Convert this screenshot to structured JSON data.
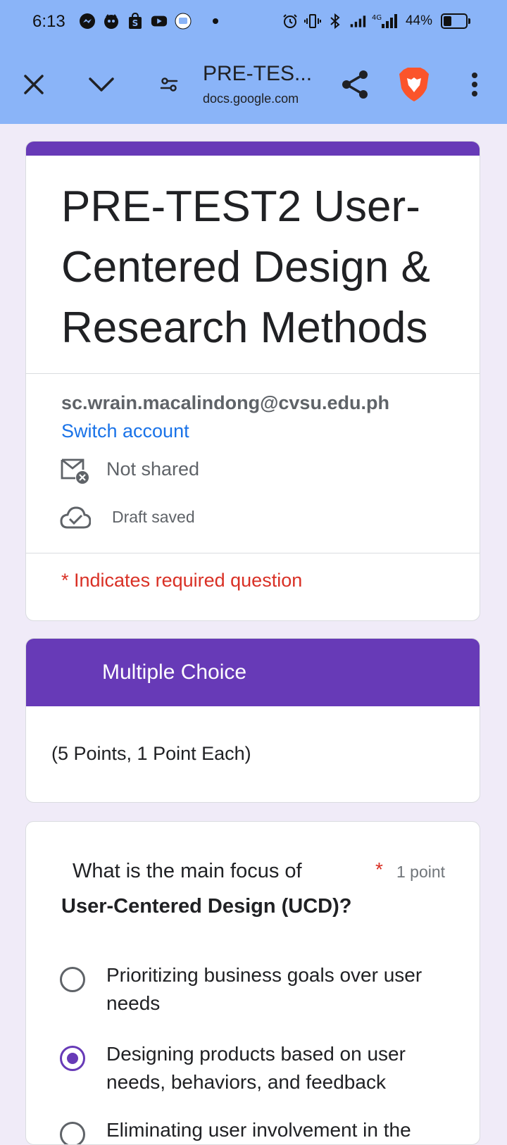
{
  "status_bar": {
    "time": "6:13",
    "network": "4G",
    "battery": "44%",
    "battery_level": 0.44,
    "icons_left": [
      "messenger-icon",
      "cat-app-icon",
      "shopee-icon",
      "youtube-icon",
      "screen-record-icon"
    ],
    "icons_right": [
      "alarm-icon",
      "vibrate-icon",
      "bluetooth-icon",
      "signal-icon",
      "signal-4g-icon"
    ]
  },
  "toolbar": {
    "title": "PRE-TES...",
    "url": "docs.google.com",
    "icons": [
      "close-icon",
      "chevron-down-icon",
      "site-settings-icon",
      "share-icon",
      "brave-lion-icon",
      "more-vert-icon"
    ]
  },
  "form": {
    "title": "PRE-TEST2 User-Centered Design & Research Methods",
    "account_email": "sc.wrain.macalindong@cvsu.edu.ph",
    "switch_account": "Switch account",
    "not_shared": "Not shared",
    "draft_saved": "Draft saved",
    "required_note": "* Indicates required question",
    "accent_color": "#673ab7"
  },
  "section": {
    "title": "Multiple Choice",
    "description": "(5 Points, 1 Point Each)"
  },
  "question": {
    "title_part1": "What is the main focus of",
    "title_part2": "User-Centered Design (UCD)?",
    "required_star": "*",
    "points": "1 point",
    "options": [
      {
        "label": "Prioritizing business goals over user needs",
        "selected": false
      },
      {
        "label": "Designing products based on user needs, behaviors, and feedback",
        "selected": true
      },
      {
        "label": "Eliminating user involvement in the",
        "selected": false
      }
    ]
  }
}
